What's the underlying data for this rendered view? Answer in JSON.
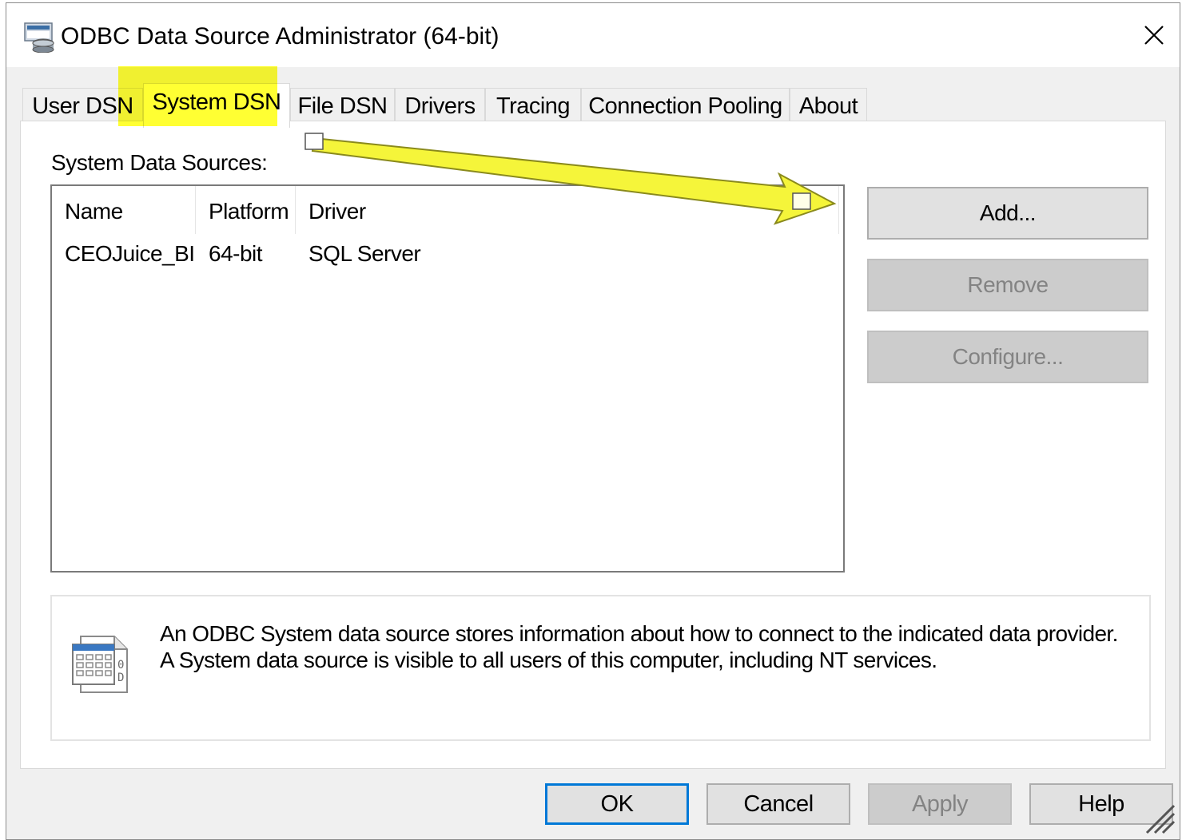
{
  "window": {
    "title": "ODBC Data Source Administrator (64-bit)"
  },
  "tabs": [
    {
      "label": "User DSN"
    },
    {
      "label": "System DSN",
      "active": true
    },
    {
      "label": "File DSN"
    },
    {
      "label": "Drivers"
    },
    {
      "label": "Tracing"
    },
    {
      "label": "Connection Pooling"
    },
    {
      "label": "About"
    }
  ],
  "panel": {
    "section_label": "System Data Sources:",
    "columns": [
      "Name",
      "Platform",
      "Driver"
    ],
    "rows": [
      {
        "name": "CEOJuice_BI",
        "platform": "64-bit",
        "driver": "SQL Server"
      }
    ]
  },
  "side_buttons": {
    "add": "Add...",
    "remove": "Remove",
    "configure": "Configure..."
  },
  "info": {
    "line1": "An ODBC System data source stores information about how to connect to the indicated data provider.",
    "line2": "A System data source is visible to all users of this computer, including NT services."
  },
  "footer_buttons": {
    "ok": "OK",
    "cancel": "Cancel",
    "apply": "Apply",
    "help": "Help"
  },
  "colors": {
    "highlight": "#ffff33",
    "arrow": "#f5f53a",
    "default_button_border": "#0078d7"
  },
  "icons": {
    "title": "odbc-admin-icon",
    "close": "close-icon",
    "info": "data-source-file-icon",
    "grip": "resize-grip-icon"
  }
}
